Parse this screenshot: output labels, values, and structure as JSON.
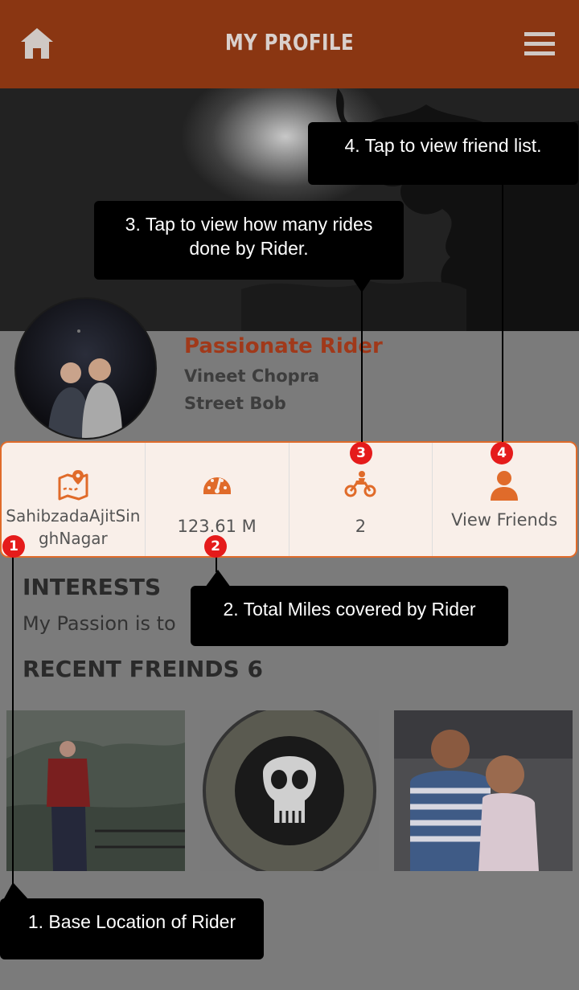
{
  "header": {
    "title": "MY PROFILE",
    "home_icon": "home-icon",
    "menu_icon": "hamburger-menu-icon"
  },
  "profile": {
    "title": "Passionate Rider",
    "name": "Vineet Chopra",
    "bike": "Street Bob"
  },
  "stats": {
    "location_line1": "SahibzadaAjitSin",
    "location_line2": "ghNagar",
    "miles": "123.61 M",
    "rides": "2",
    "friends": "View Friends"
  },
  "interests": {
    "heading": "INTERESTS",
    "text": "My Passion is to"
  },
  "recent_friends": {
    "heading": "RECENT FREINDS 6"
  },
  "tooltips": {
    "tip1": "1. Base Location of Rider",
    "tip2": "2. Total Miles covered by Rider",
    "tip3": "3. Tap to view how many rides done by Rider.",
    "tip4": "4. Tap to view friend list."
  },
  "badges": {
    "b1": "1",
    "b2": "2",
    "b3": "3",
    "b4": "4"
  },
  "colors": {
    "header": "#8a3612",
    "accent": "#e06b2a",
    "title_red": "#a0391a",
    "badge": "#e51b1b"
  }
}
